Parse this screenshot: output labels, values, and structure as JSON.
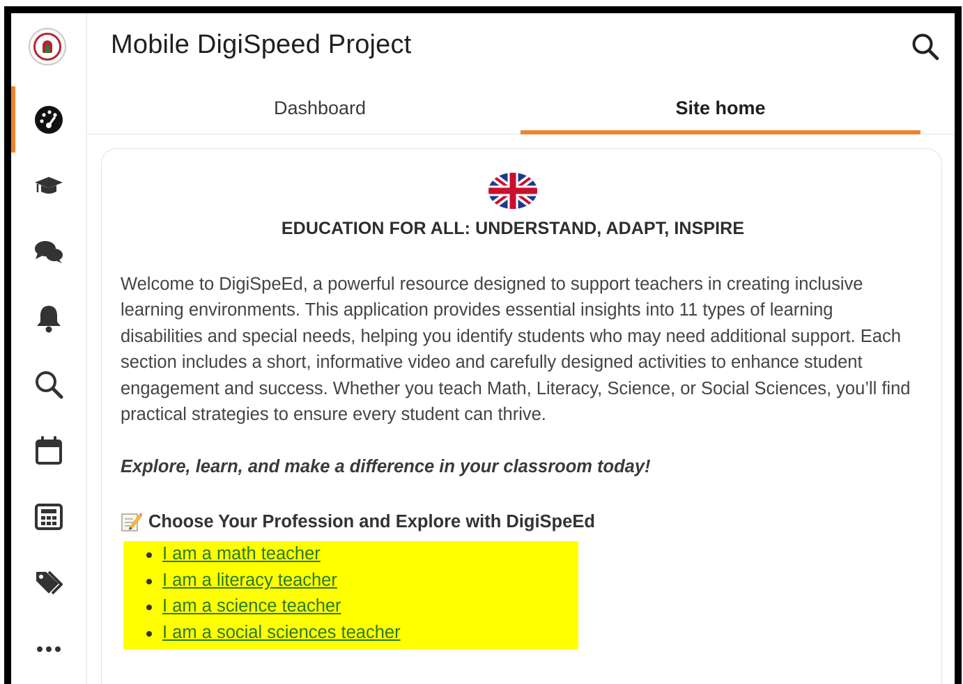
{
  "app": {
    "title": "Mobile DigiSpeed Project"
  },
  "sidebar": {
    "items": [
      {
        "icon": "dashboard-gauge-icon",
        "active": true
      },
      {
        "icon": "graduation-cap-icon",
        "active": false
      },
      {
        "icon": "messages-icon",
        "active": false
      },
      {
        "icon": "bell-icon",
        "active": false
      },
      {
        "icon": "search-icon",
        "active": false
      },
      {
        "icon": "calendar-icon",
        "active": false
      },
      {
        "icon": "grades-table-icon",
        "active": false
      },
      {
        "icon": "tags-icon",
        "active": false
      },
      {
        "icon": "more-icon",
        "active": false
      }
    ]
  },
  "tabs": [
    {
      "label": "Dashboard",
      "active": false
    },
    {
      "label": "Site home",
      "active": true
    }
  ],
  "content": {
    "heading": "EDUCATION FOR ALL: UNDERSTAND, ADAPT, INSPIRE",
    "intro": "Welcome to DigiSpeEd, a powerful resource designed to support teachers in creating inclusive learning environments. This application provides essential insights into 11 types of learning disabilities and special needs, helping you identify students who may need additional support. Each section includes a short, informative video and carefully designed activities to enhance student engagement and success. Whether you teach Math, Literacy, Science, or Social Sciences, you’ll find practical strategies to ensure every student can thrive.",
    "tagline": "Explore, learn, and make a difference in your classroom today!",
    "choose_title": "Choose Your Profession and Explore with DigiSpeEd",
    "links": [
      "I am a math teacher",
      "I am a literacy teacher",
      "I am a science teacher",
      "I am a social sciences teacher"
    ]
  },
  "colors": {
    "accent": "#f0832b",
    "highlight": "#ffff00",
    "link": "#2a7a23"
  }
}
